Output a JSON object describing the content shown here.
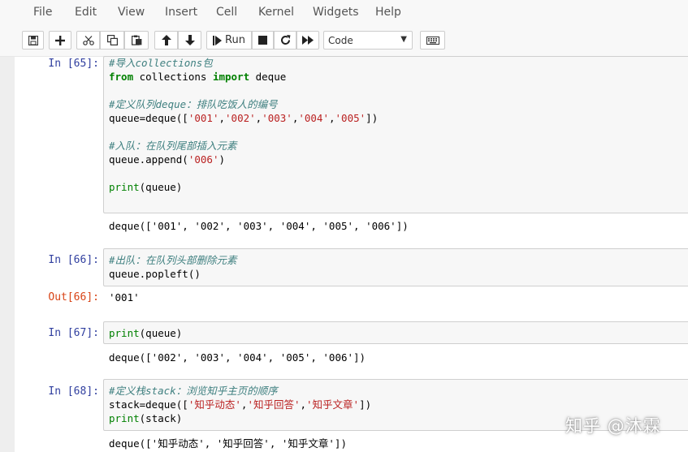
{
  "menu": {
    "items": [
      {
        "label": "File"
      },
      {
        "label": "Edit"
      },
      {
        "label": "View"
      },
      {
        "label": "Insert"
      },
      {
        "label": "Cell"
      },
      {
        "label": "Kernel"
      },
      {
        "label": "Widgets"
      },
      {
        "label": "Help"
      }
    ]
  },
  "toolbar": {
    "run_label": "Run",
    "cell_type": "Code"
  },
  "cells": [
    {
      "prompt": "In [65]:",
      "lines": [
        [
          {
            "t": "#导入collections包",
            "c": "cm"
          }
        ],
        [
          {
            "t": "from",
            "c": "kw"
          },
          {
            "t": " collections ",
            "c": ""
          },
          {
            "t": "import",
            "c": "kw"
          },
          {
            "t": " deque",
            "c": ""
          }
        ],
        [],
        [
          {
            "t": "#定义队列deque：排队吃饭人的编号",
            "c": "cm"
          }
        ],
        [
          {
            "t": "queue=deque([",
            "c": ""
          },
          {
            "t": "'001'",
            "c": "st"
          },
          {
            "t": ",",
            "c": ""
          },
          {
            "t": "'002'",
            "c": "st"
          },
          {
            "t": ",",
            "c": ""
          },
          {
            "t": "'003'",
            "c": "st"
          },
          {
            "t": ",",
            "c": ""
          },
          {
            "t": "'004'",
            "c": "st"
          },
          {
            "t": ",",
            "c": ""
          },
          {
            "t": "'005'",
            "c": "st"
          },
          {
            "t": "])",
            "c": ""
          }
        ],
        [],
        [
          {
            "t": "#入队：在队列尾部插入元素",
            "c": "cm"
          }
        ],
        [
          {
            "t": "queue.append(",
            "c": ""
          },
          {
            "t": "'006'",
            "c": "st"
          },
          {
            "t": ")",
            "c": ""
          }
        ],
        [],
        [
          {
            "t": "print",
            "c": "bi"
          },
          {
            "t": "(queue)",
            "c": ""
          }
        ]
      ],
      "output": "deque(['001', '002', '003', '004', '005', '006'])"
    },
    {
      "prompt": "In [66]:",
      "lines": [
        [
          {
            "t": "#出队：在队列头部删除元素",
            "c": "cm"
          }
        ],
        [
          {
            "t": "queue.popleft()",
            "c": ""
          }
        ]
      ],
      "out_prompt": "Out[66]:",
      "output": "'001'"
    },
    {
      "prompt": "In [67]:",
      "lines": [
        [
          {
            "t": "print",
            "c": "bi"
          },
          {
            "t": "(queue)",
            "c": ""
          }
        ]
      ],
      "output": "deque(['002', '003', '004', '005', '006'])"
    },
    {
      "prompt": "In [68]:",
      "lines": [
        [
          {
            "t": "#定义栈stack：浏览知乎主页的顺序",
            "c": "cm"
          }
        ],
        [
          {
            "t": "stack=deque([",
            "c": ""
          },
          {
            "t": "'知乎动态'",
            "c": "st"
          },
          {
            "t": ",",
            "c": ""
          },
          {
            "t": "'知乎回答'",
            "c": "st"
          },
          {
            "t": ",",
            "c": ""
          },
          {
            "t": "'知乎文章'",
            "c": "st"
          },
          {
            "t": "])",
            "c": ""
          }
        ],
        [
          {
            "t": "print",
            "c": "bi"
          },
          {
            "t": "(stack)",
            "c": ""
          }
        ]
      ],
      "output": "deque(['知乎动态', '知乎回答', '知乎文章'])"
    }
  ],
  "watermark": "知乎 @沐霖"
}
